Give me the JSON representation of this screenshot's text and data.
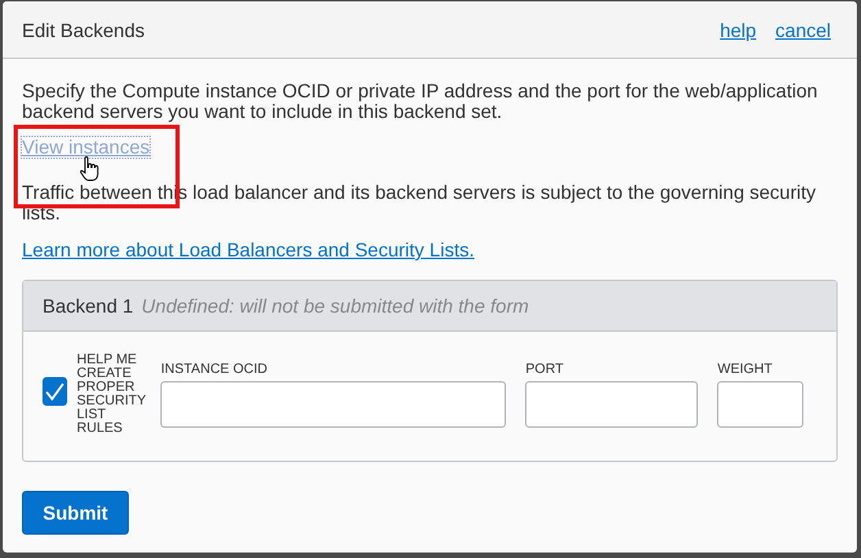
{
  "dialog": {
    "title": "Edit Backends",
    "header_links": [
      "help",
      "cancel"
    ]
  },
  "intro": "Specify the Compute instance OCID or private IP address and the port for the web/application backend servers you want to include in this backend set.",
  "view_link": {
    "label": "View instances",
    "highlighted": true
  },
  "traffic_note": "Traffic between this load balancer and its backend servers is subject to the governing security lists.",
  "learn_link": "Learn more about Load Balancers and Security Lists.",
  "backend": {
    "title": "Backend 1",
    "status": "Undefined: will not be submitted with the form",
    "checkbox": {
      "label": "HELP ME CREATE PROPER SECURITY LIST RULES",
      "checked": true
    },
    "fields": [
      {
        "label": "INSTANCE OCID",
        "kind": "wide"
      },
      {
        "label": "PORT",
        "kind": "medium"
      },
      {
        "label": "WEIGHT",
        "kind": "narrow"
      }
    ]
  },
  "submit": "Submit"
}
